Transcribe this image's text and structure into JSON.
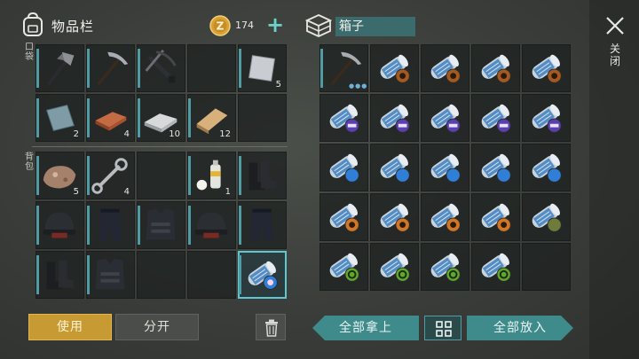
{
  "inventory": {
    "title": "物品栏",
    "coins": "174",
    "pockets_label": "口袋",
    "backpack_label": "背包",
    "pockets": [
      {
        "icon": "axe-icon",
        "qty": ""
      },
      {
        "icon": "pickaxe-icon",
        "qty": ""
      },
      {
        "icon": "crossbow-icon",
        "qty": ""
      },
      {
        "icon": "",
        "qty": ""
      },
      {
        "icon": "iron-sheet-icon",
        "qty": "5"
      },
      {
        "icon": "metal-plate-icon",
        "qty": "2"
      },
      {
        "icon": "copper-ingot-icon",
        "qty": "4"
      },
      {
        "icon": "iron-ingot-icon",
        "qty": "10"
      },
      {
        "icon": "wood-plank-icon",
        "qty": "12"
      },
      {
        "icon": "",
        "qty": ""
      }
    ],
    "backpack": [
      {
        "icon": "ore-rock-icon",
        "qty": "5"
      },
      {
        "icon": "wrench-icon",
        "qty": "4"
      },
      {
        "icon": "",
        "qty": ""
      },
      {
        "icon": "spray-can-icon",
        "qty": "1"
      },
      {
        "icon": "boots-icon",
        "qty": ""
      },
      {
        "icon": "tactical-helmet-icon",
        "qty": ""
      },
      {
        "icon": "tactical-pants-icon",
        "qty": ""
      },
      {
        "icon": "armored-vest-icon",
        "qty": ""
      },
      {
        "icon": "tactical-helmet-icon",
        "qty": ""
      },
      {
        "icon": "tactical-pants-icon",
        "qty": ""
      },
      {
        "icon": "boots-icon",
        "qty": ""
      },
      {
        "icon": "armored-vest-icon",
        "qty": ""
      },
      {
        "icon": "",
        "qty": ""
      },
      {
        "icon": "",
        "qty": ""
      },
      {
        "icon": "blueprint-scroll-pink-icon",
        "qty": "",
        "selected": true
      }
    ],
    "use_label": "使用",
    "split_label": "分开"
  },
  "box": {
    "title": "箱子",
    "close_label": "关闭",
    "take_all_label": "全部拿上",
    "put_all_label": "全部放入",
    "slots": [
      {
        "icon": "pickaxe-icon"
      },
      {
        "icon": "blueprint-scroll-gear-icon",
        "badge": "#a3591f"
      },
      {
        "icon": "blueprint-scroll-gear-icon",
        "badge": "#a3591f"
      },
      {
        "icon": "blueprint-scroll-gear-icon",
        "badge": "#a3591f"
      },
      {
        "icon": "blueprint-scroll-gear-icon",
        "badge": "#a3591f"
      },
      {
        "icon": "blueprint-scroll-purple-icon",
        "badge": "#5a3fb0"
      },
      {
        "icon": "blueprint-scroll-purple-icon",
        "badge": "#5a3fb0"
      },
      {
        "icon": "blueprint-scroll-purple-icon",
        "badge": "#5a3fb0"
      },
      {
        "icon": "blueprint-scroll-purple-icon",
        "badge": "#5a3fb0"
      },
      {
        "icon": "blueprint-scroll-purple-icon",
        "badge": "#5a3fb0"
      },
      {
        "icon": "blueprint-scroll-blue-icon",
        "badge": "#2f7ed8"
      },
      {
        "icon": "blueprint-scroll-blue-icon",
        "badge": "#2f7ed8"
      },
      {
        "icon": "blueprint-scroll-blue-icon",
        "badge": "#2f7ed8"
      },
      {
        "icon": "blueprint-scroll-blue-icon",
        "badge": "#2f7ed8"
      },
      {
        "icon": "blueprint-scroll-blue-icon",
        "badge": "#2f7ed8"
      },
      {
        "icon": "blueprint-scroll-orange-icon",
        "badge": "#d07624"
      },
      {
        "icon": "blueprint-scroll-orange-icon",
        "badge": "#d07624"
      },
      {
        "icon": "blueprint-scroll-orange-icon",
        "badge": "#d07624"
      },
      {
        "icon": "blueprint-scroll-orange-icon",
        "badge": "#d07624"
      },
      {
        "icon": "blueprint-scroll-camo-icon",
        "badge": "#6f7b3a"
      },
      {
        "icon": "blueprint-scroll-biohazard-icon",
        "badge": "#5fa82c"
      },
      {
        "icon": "blueprint-scroll-biohazard-icon",
        "badge": "#5fa82c"
      },
      {
        "icon": "blueprint-scroll-biohazard-icon",
        "badge": "#5fa82c"
      },
      {
        "icon": "blueprint-scroll-biohazard-icon",
        "badge": "#5fa82c"
      },
      {
        "icon": ""
      }
    ]
  },
  "colors": {
    "accent_teal": "#3f8a8b",
    "use_button": "#c79a33",
    "coin": "#d8a23a"
  }
}
